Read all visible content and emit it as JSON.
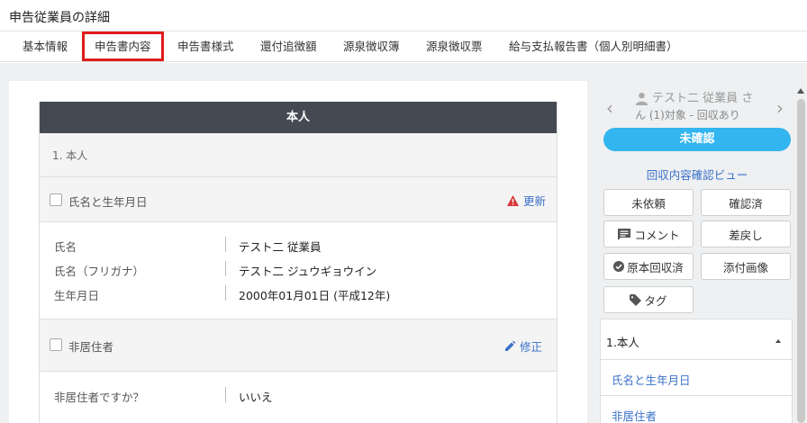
{
  "page": {
    "title": "申告従業員の詳細"
  },
  "tabs": [
    {
      "label": "基本情報"
    },
    {
      "label": "申告書内容"
    },
    {
      "label": "申告書様式"
    },
    {
      "label": "還付追徴額"
    },
    {
      "label": "源泉徴収簿"
    },
    {
      "label": "源泉徴収票"
    },
    {
      "label": "給与支払報告書（個人別明細書）"
    }
  ],
  "form": {
    "header": "本人",
    "section_title": "1. 本人",
    "groups": [
      {
        "label": "氏名と生年月日",
        "action": "更新",
        "action_icon": "warning-icon",
        "fields": [
          {
            "label": "氏名",
            "value": "テスト二 従業員"
          },
          {
            "label": "氏名（フリガナ）",
            "value": "テスト二 ジュウギョウイン"
          },
          {
            "label": "生年月日",
            "value": "2000年01月01日 (平成12年)"
          }
        ]
      },
      {
        "label": "非居住者",
        "action": "修正",
        "action_icon": "pencil-icon",
        "fields": [
          {
            "label": "非居住者ですか？",
            "value": "いいえ"
          }
        ]
      }
    ]
  },
  "sidebar": {
    "employee_name": "テスト二 従業員 さ",
    "employee_sub": "ん (1)対象 - 回収あり",
    "status": "未確認",
    "view_link": "回収内容確認ビュー",
    "buttons": {
      "not_requested": "未依頼",
      "confirmed": "確認済",
      "comment": "コメント",
      "return": "差戻し",
      "original_collected": "原本回収済",
      "attached_image": "添付画像",
      "tag": "タグ"
    },
    "accordion": {
      "title": "1.本人",
      "items": [
        "氏名と生年月日",
        "非居住者"
      ]
    }
  },
  "colors": {
    "accent_red": "#e01b1b",
    "status_blue": "#33b5ef",
    "link_blue": "#3a70c8",
    "header_dark": "#454a52"
  }
}
